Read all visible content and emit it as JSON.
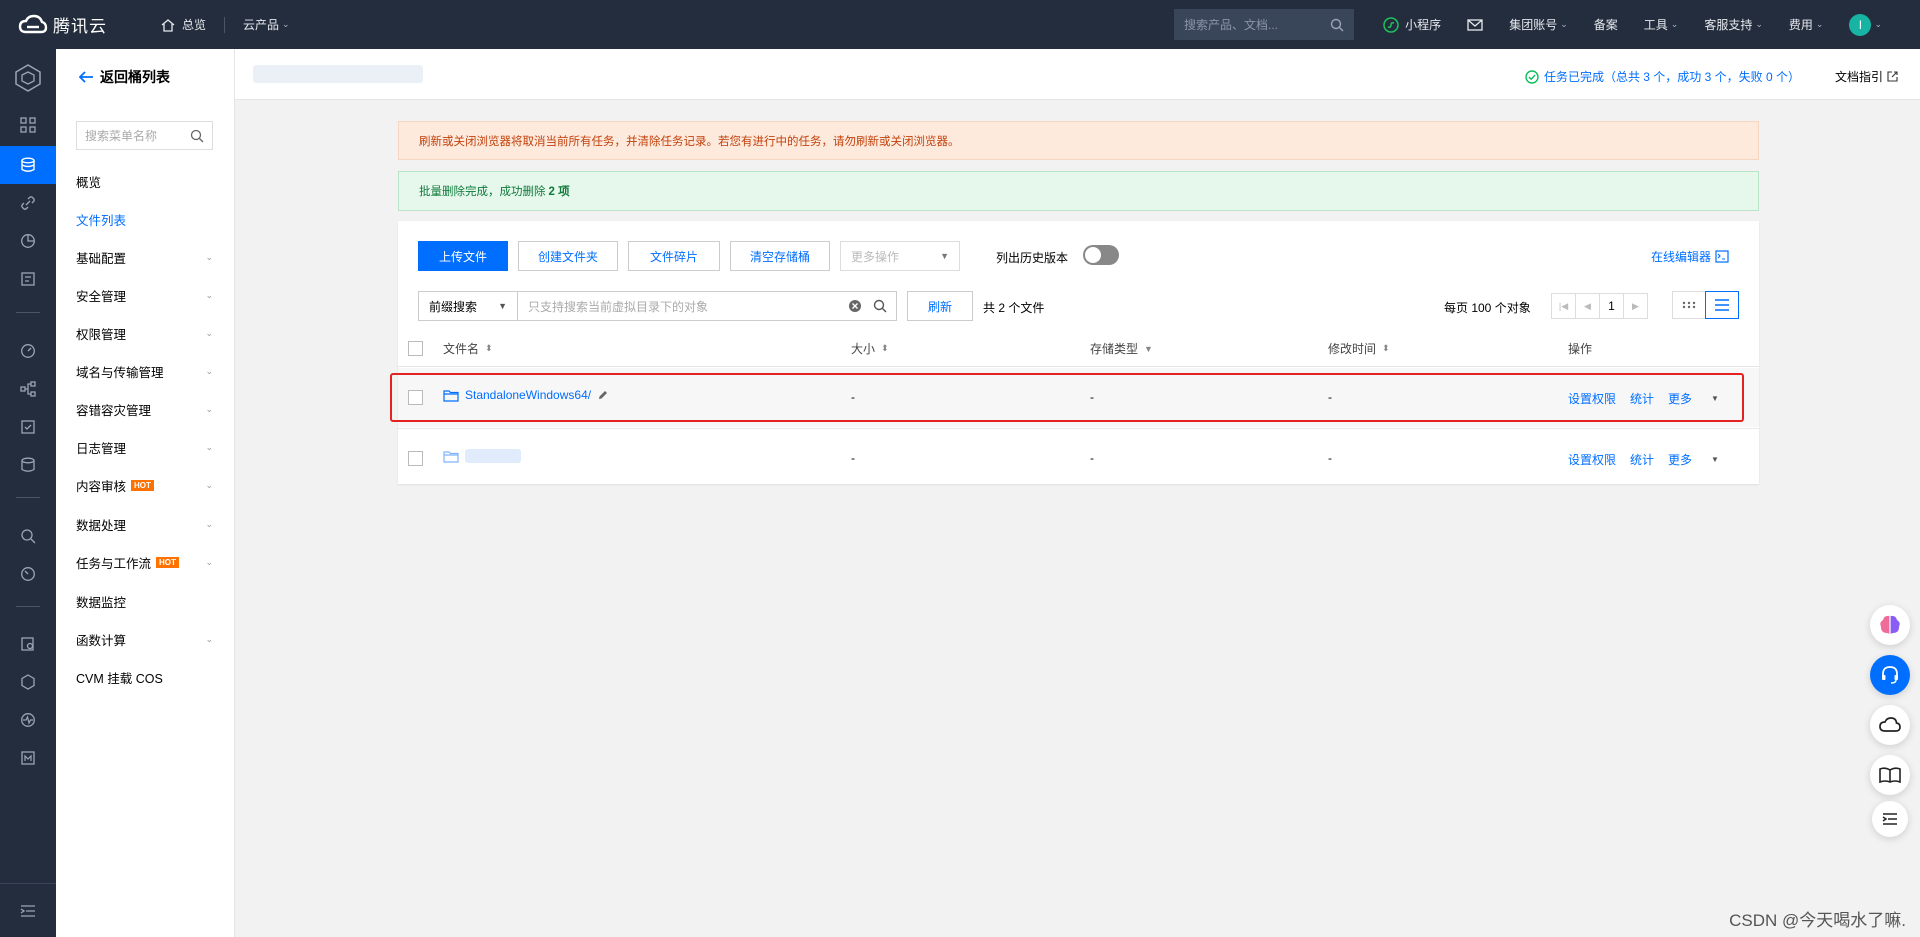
{
  "topbar": {
    "brand": "腾讯云",
    "overview": "总览",
    "products": "云产品",
    "search_placeholder": "搜索产品、文档...",
    "miniprogram": "小程序",
    "group_account": "集团账号",
    "icp": "备案",
    "tools": "工具",
    "support": "客服支持",
    "billing": "费用",
    "avatar_letter": "I"
  },
  "sidebar": {
    "back_label": "返回桶列表",
    "search_placeholder": "搜索菜单名称",
    "hot_badge": "HOT",
    "items": [
      {
        "label": "概览"
      },
      {
        "label": "文件列表"
      },
      {
        "label": "基础配置"
      },
      {
        "label": "安全管理"
      },
      {
        "label": "权限管理"
      },
      {
        "label": "域名与传输管理"
      },
      {
        "label": "容错容灾管理"
      },
      {
        "label": "日志管理"
      },
      {
        "label": "内容审核"
      },
      {
        "label": "数据处理"
      },
      {
        "label": "任务与工作流"
      },
      {
        "label": "数据监控"
      },
      {
        "label": "函数计算"
      },
      {
        "label": "CVM 挂载 COS"
      }
    ]
  },
  "header": {
    "task_status": "任务已完成（总共 3 个，成功 3 个，失败 0 个）",
    "doc_guide": "文档指引"
  },
  "alerts": {
    "warning": "刷新或关闭浏览器将取消当前所有任务，并清除任务记录。若您有进行中的任务，请勿刷新或关闭浏览器。",
    "success_prefix": "批量删除完成，成功删除 ",
    "success_count": "2 项"
  },
  "toolbar": {
    "upload": "上传文件",
    "create_folder": "创建文件夹",
    "fragments": "文件碎片",
    "clear_bucket": "清空存储桶",
    "more_ops": "更多操作",
    "history_label": "列出历史版本",
    "online_editor": "在线编辑器"
  },
  "filter": {
    "mode": "前缀搜索",
    "search_placeholder": "只支持搜索当前虚拟目录下的对象",
    "refresh": "刷新",
    "total": "共 2 个文件",
    "per_page": "每页 100 个对象",
    "page": "1"
  },
  "table": {
    "headers": {
      "name": "文件名",
      "size": "大小",
      "storage": "存储类型",
      "modified": "修改时间",
      "actions": "操作"
    },
    "rows": [
      {
        "name": "StandaloneWindows64/",
        "size": "-",
        "storage": "-",
        "modified": "-"
      },
      {
        "name": "",
        "size": "-",
        "storage": "-",
        "modified": "-"
      }
    ],
    "op_permissions": "设置权限",
    "op_stats": "统计",
    "op_more": "更多"
  },
  "watermark": "CSDN @今天喝水了嘛."
}
